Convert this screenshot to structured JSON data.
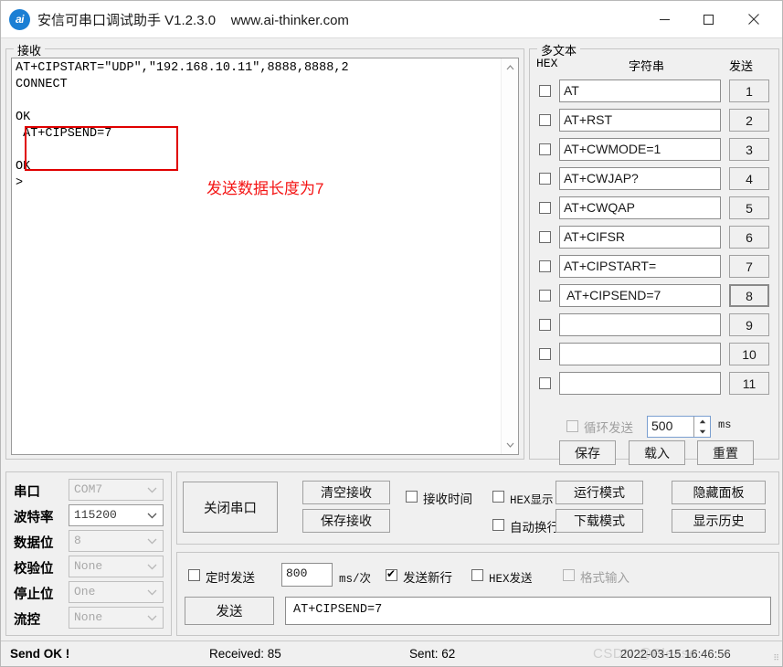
{
  "window": {
    "logo_text": "ai",
    "title": "安信可串口调试助手 V1.2.3.0    www.ai-thinker.com",
    "minimize_label": "minimize",
    "maximize_label": "maximize",
    "close_label": "close"
  },
  "receive": {
    "group_label": "接收",
    "content": "AT+CIPSTART=\"UDP\",\"192.168.10.11\",8888,8888,2\nCONNECT\n\nOK\n AT+CIPSEND=7\n\nOK\n>",
    "annotation": "发送数据长度为7",
    "annotation_color": "#f41414",
    "highlight_color": "#e00000",
    "scroll_up_icon": "chevron-up-icon",
    "scroll_down_icon": "chevron-down-icon"
  },
  "multitext": {
    "group_label": "多文本",
    "header_hex": "HEX",
    "header_string": "字符串",
    "header_send": "发送",
    "rows": [
      {
        "value": "AT",
        "send_label": "1",
        "checked": false,
        "focused": false
      },
      {
        "value": "AT+RST",
        "send_label": "2",
        "checked": false,
        "focused": false
      },
      {
        "value": "AT+CWMODE=1",
        "send_label": "3",
        "checked": false,
        "focused": false
      },
      {
        "value": "AT+CWJAP?",
        "send_label": "4",
        "checked": false,
        "focused": false
      },
      {
        "value": "AT+CWQAP",
        "send_label": "5",
        "checked": false,
        "focused": false
      },
      {
        "value": "AT+CIFSR",
        "send_label": "6",
        "checked": false,
        "focused": false
      },
      {
        "value": "AT+CIPSTART=",
        "send_label": "7",
        "checked": false,
        "focused": false
      },
      {
        "value": " AT+CIPSEND=7",
        "send_label": "8",
        "checked": false,
        "focused": true
      },
      {
        "value": "",
        "send_label": "9",
        "checked": false,
        "focused": false
      },
      {
        "value": "",
        "send_label": "10",
        "checked": false,
        "focused": false
      },
      {
        "value": "",
        "send_label": "11",
        "checked": false,
        "focused": false
      }
    ],
    "loop_send_label": "循环发送",
    "loop_send_checked": false,
    "loop_send_disabled": true,
    "loop_interval": "500",
    "loop_unit": "ms",
    "save_label": "保存",
    "load_label": "载入",
    "reset_label": "重置"
  },
  "serial": {
    "rows": [
      {
        "label": "串口",
        "value": "COM7",
        "enabled": false
      },
      {
        "label": "波特率",
        "value": "115200",
        "enabled": true
      },
      {
        "label": "数据位",
        "value": "8",
        "enabled": false
      },
      {
        "label": "校验位",
        "value": "None",
        "enabled": false
      },
      {
        "label": "停止位",
        "value": "One",
        "enabled": false
      },
      {
        "label": "流控",
        "value": "None",
        "enabled": false
      }
    ]
  },
  "controls": {
    "close_port_label": "关闭串口",
    "clear_recv_label": "清空接收",
    "save_recv_label": "保存接收",
    "recv_time_label": "接收时间",
    "recv_time_checked": false,
    "hex_show_label": "HEX显示",
    "hex_show_checked": false,
    "auto_wrap_label": "自动换行",
    "auto_wrap_checked": false,
    "run_mode_label": "运行模式",
    "download_mode_label": "下载模式",
    "hide_panel_label": "隐藏面板",
    "show_history_label": "显示历史"
  },
  "send": {
    "timed_send_label": "定时发送",
    "timed_send_checked": false,
    "timed_interval": "800",
    "timed_unit": "ms/次",
    "newline_label": "发送新行",
    "newline_checked": true,
    "hex_send_label": "HEX发送",
    "hex_send_checked": false,
    "format_input_label": "格式输入",
    "format_input_checked": false,
    "format_input_disabled": true,
    "send_button_label": "发送",
    "send_value": "AT+CIPSEND=7"
  },
  "status": {
    "message": "Send OK !",
    "received": "Received: 85",
    "sent": "Sent: 62",
    "timestamp": "2022-03-15 16:46:56",
    "watermark": "CSDN @Please"
  }
}
